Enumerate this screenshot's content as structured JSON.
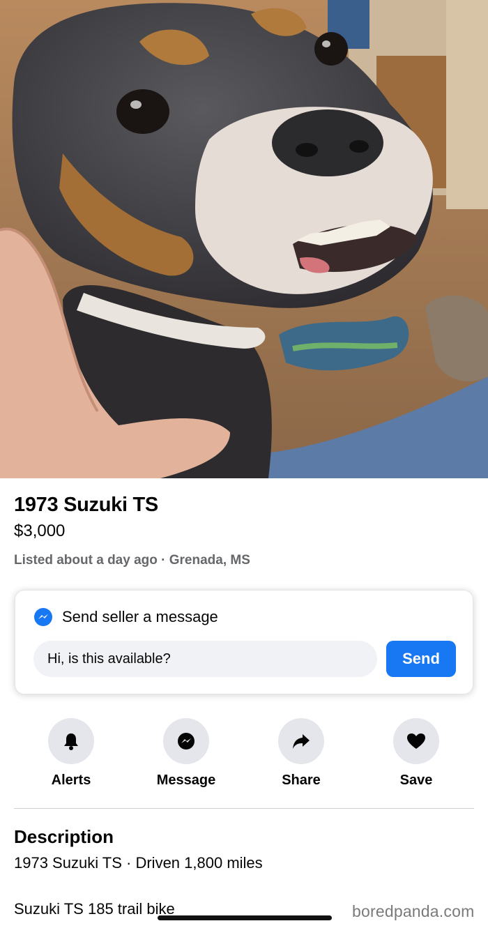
{
  "listing": {
    "title": "1973 Suzuki TS",
    "price": "$3,000",
    "meta": "Listed about a day ago · Grenada, MS"
  },
  "message_card": {
    "heading": "Send seller a message",
    "input_value": "Hi, is this available?",
    "send_label": "Send",
    "accent_color": "#1877f2"
  },
  "actions": [
    {
      "label": "Alerts",
      "icon": "bell-icon"
    },
    {
      "label": "Message",
      "icon": "messenger-icon"
    },
    {
      "label": "Share",
      "icon": "share-arrow-icon"
    },
    {
      "label": "Save",
      "icon": "heart-icon"
    }
  ],
  "description": {
    "heading": "Description",
    "summary": "1973 Suzuki TS · Driven 1,800 miles",
    "body": "Suzuki TS 185 trail bike"
  },
  "watermark": "boredpanda.com"
}
